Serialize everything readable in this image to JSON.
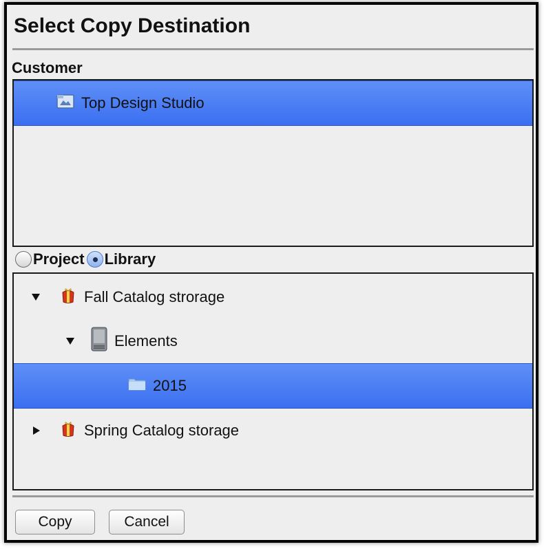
{
  "dialog": {
    "title": "Select Copy Destination"
  },
  "customer": {
    "label": "Customer",
    "items": [
      {
        "label": "Top Design Studio",
        "icon": "customer-icon",
        "selected": true
      }
    ]
  },
  "scope": {
    "options": [
      {
        "label": "Project",
        "checked": false
      },
      {
        "label": "Library",
        "checked": true
      }
    ]
  },
  "tree": {
    "items": [
      {
        "label": "Fall Catalog strorage",
        "icon": "gift-icon",
        "expanded": true,
        "level": 0
      },
      {
        "label": "Elements",
        "icon": "storage-device-icon",
        "expanded": true,
        "level": 1
      },
      {
        "label": "2015",
        "icon": "folder-icon",
        "level": 2,
        "selected": true
      },
      {
        "label": "Spring Catalog storage",
        "icon": "gift-icon",
        "expanded": false,
        "level": 0
      }
    ]
  },
  "buttons": {
    "copy": "Copy",
    "cancel": "Cancel"
  },
  "colors": {
    "selection": "#4a7ef4",
    "background": "#eeeeee"
  }
}
